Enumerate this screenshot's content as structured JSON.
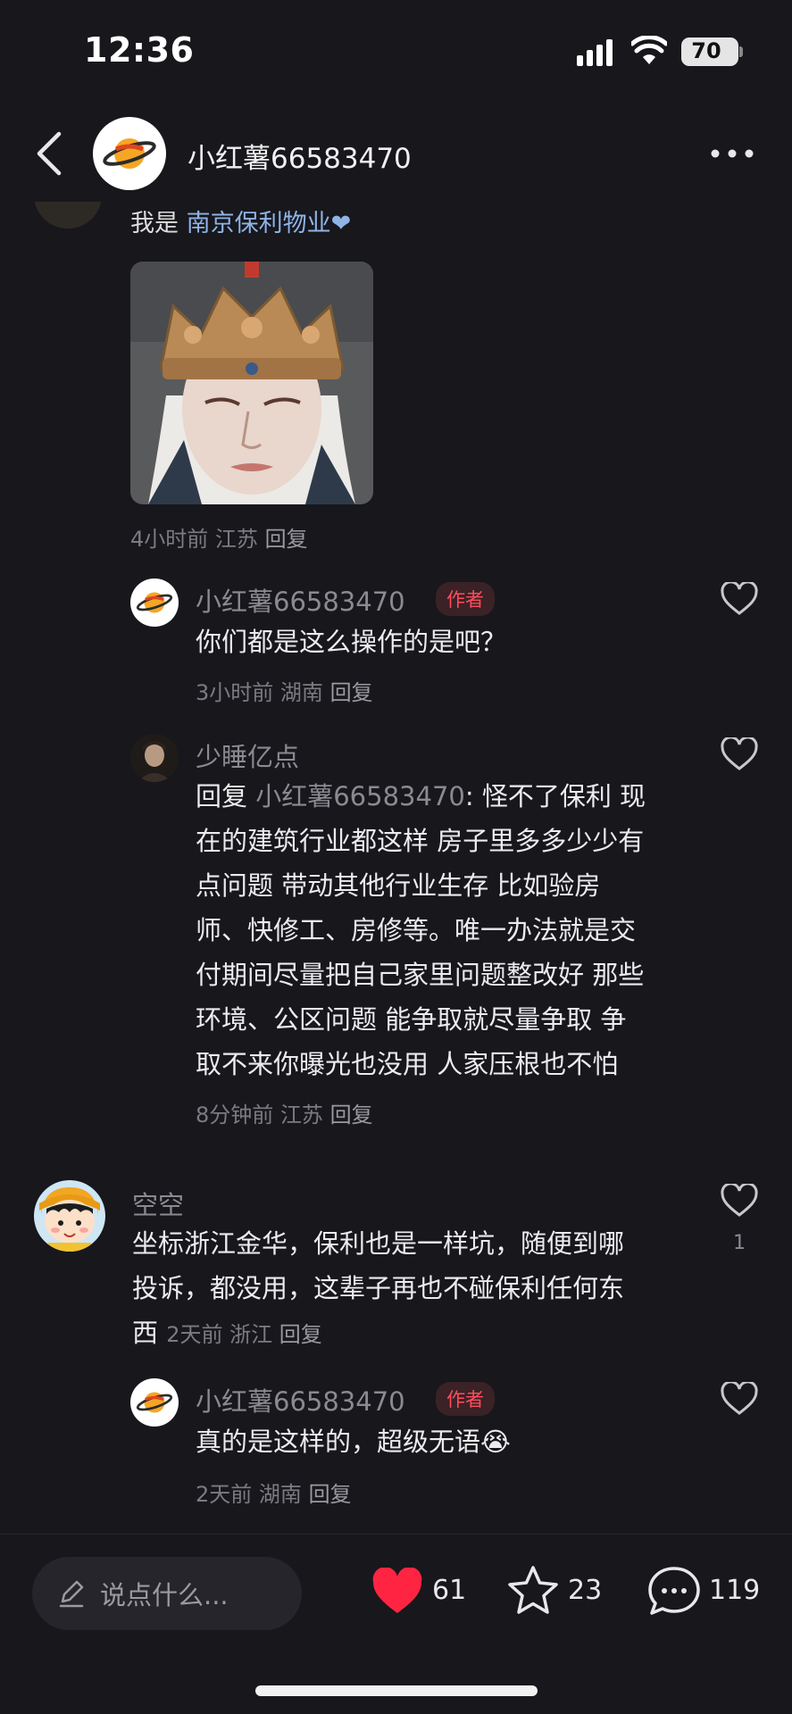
{
  "status_bar": {
    "time": "12:36",
    "battery": "70"
  },
  "header": {
    "title": "小红薯66583470"
  },
  "top_comment": {
    "text_prefix": "我是",
    "text_link": "南京保利物业",
    "meta_time": "4小时前",
    "meta_loc": "江苏",
    "meta_reply": "回复"
  },
  "replies_a": [
    {
      "name": "小红薯66583470",
      "tag": "作者",
      "text": "你们都是这么操作的是吧？",
      "meta_time": "3小时前",
      "meta_loc": "湖南",
      "meta_reply": "回复"
    },
    {
      "name": "少睡亿点",
      "reply_prefix": "回复",
      "reply_to": "小红薯66583470",
      "lines": [
        ": 怪不了保利 现",
        "在的建筑行业都这样 房子里多多少少有",
        "点问题 带动其他行业生存 比如验房",
        "师、快修工、房修等。唯一办法就是交",
        "付期间尽量把自己家里问题整改好 那些",
        "环境、公区问题 能争取就尽量争取 争",
        "取不来你曝光也没用 人家压根也不怕"
      ],
      "meta_time": "8分钟前",
      "meta_loc": "江苏",
      "meta_reply": "回复"
    }
  ],
  "comment_b": {
    "name": "空空",
    "lines": [
      "坐标浙江金华，保利也是一样坑，随便到哪",
      "投诉，都没用，这辈子再也不碰保利任何东",
      "西"
    ],
    "meta_time": "2天前",
    "meta_loc": "浙江",
    "meta_reply": "回复",
    "like_count": "1"
  },
  "reply_b": {
    "name": "小红薯66583470",
    "tag": "作者",
    "text": "真的是这样的，超级无语",
    "emoji": "😭",
    "meta_time": "2天前",
    "meta_loc": "湖南",
    "meta_reply": "回复"
  },
  "bottom_bar": {
    "input_placeholder": "说点什么...",
    "likes": "61",
    "stars": "23",
    "comments": "119"
  },
  "colors": {
    "accent": "#ff2442",
    "background": "#17171c"
  }
}
